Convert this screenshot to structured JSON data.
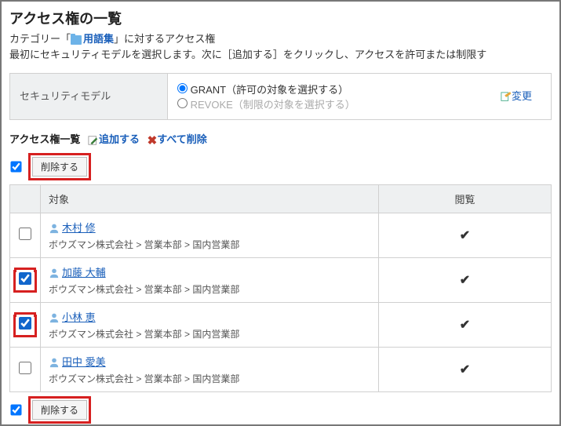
{
  "header": {
    "title": "アクセス権の一覧",
    "subtitle_prefix": "カテゴリー「",
    "category": "用語集",
    "subtitle_suffix": "」に対するアクセス権",
    "instruction": "最初にセキュリティモデルを選択します。次に［追加する］をクリックし、アクセスを許可または制限す"
  },
  "security_model": {
    "label": "セキュリティモデル",
    "grant": "GRANT（許可の対象を選択する）",
    "revoke": "REVOKE（制限の対象を選択する）",
    "change": "変更"
  },
  "list": {
    "heading": "アクセス権一覧",
    "add": "追加する",
    "delete_all": "すべて削除",
    "delete": "削除する",
    "col_target": "対象",
    "col_view": "閲覧"
  },
  "rows": [
    {
      "name": "木村 修",
      "path": "ボウズマン株式会社 > 営業本部 > 国内営業部",
      "checked": false,
      "highlight": false
    },
    {
      "name": "加藤 大輔",
      "path": "ボウズマン株式会社 > 営業本部 > 国内営業部",
      "checked": true,
      "highlight": false
    },
    {
      "name": "小林 恵",
      "path": "ボウズマン株式会社 > 営業本部 > 国内営業部",
      "checked": true,
      "highlight": true
    },
    {
      "name": "田中 愛美",
      "path": "ボウズマン株式会社 > 営業本部 > 国内営業部",
      "checked": false,
      "highlight": false
    }
  ]
}
